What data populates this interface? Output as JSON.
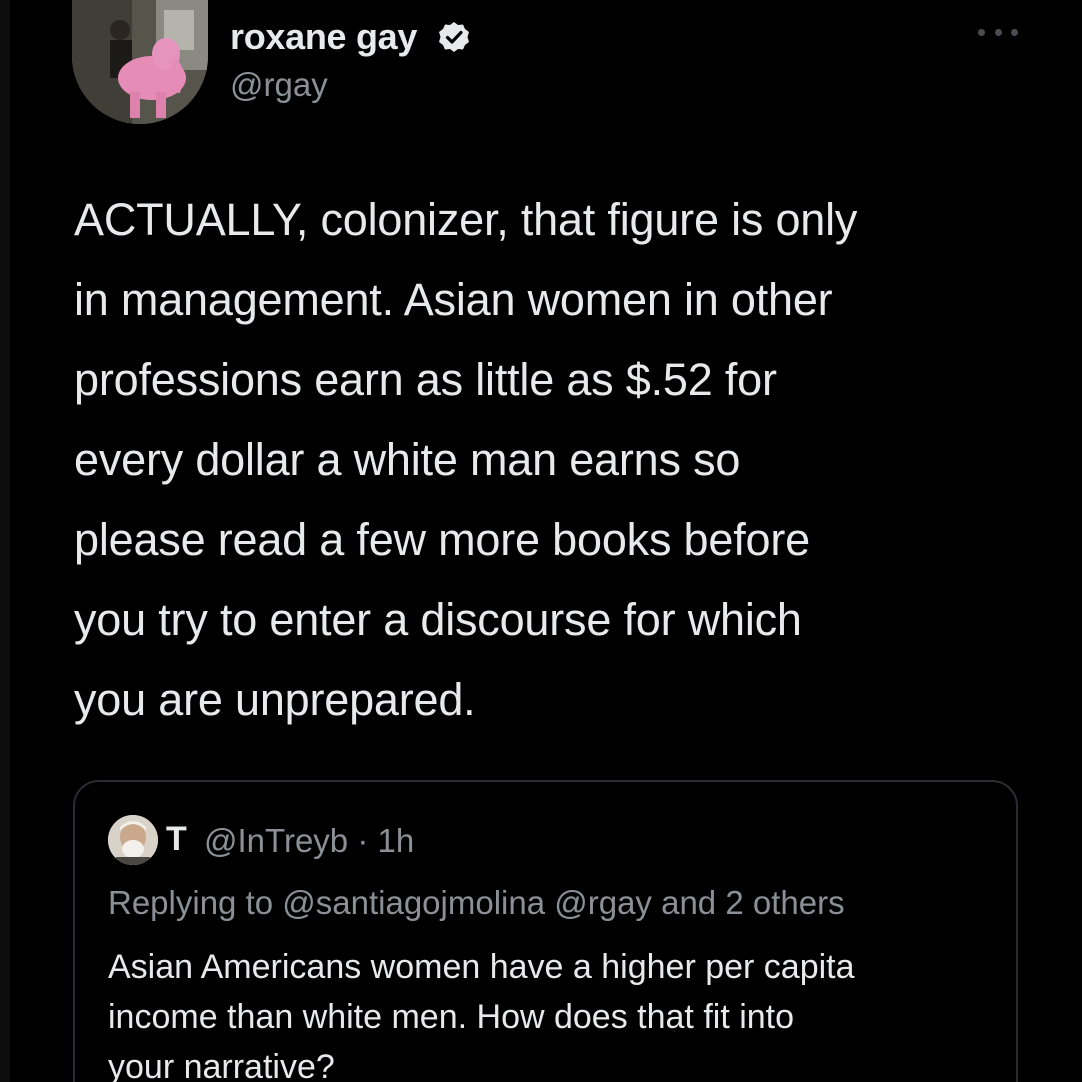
{
  "tweet": {
    "author_name": "roxane gay",
    "author_handle": "@rgay",
    "text_lines": [
      "ACTUALLY, colonizer, that figure is only",
      "in management. Asian women in other",
      "professions earn as little as $.52 for",
      "every dollar a white man earns so",
      "please read a few more books before",
      "you try to enter a discourse for which",
      "you are unprepared."
    ]
  },
  "quoted_tweet": {
    "author_name": "T",
    "author_handle_time": "@InTreyb · 1h",
    "replying_to": "Replying to @santiagojmolina @rgay and 2 others",
    "text_lines": [
      "Asian Americans women have a higher per capita",
      "income than white men.  How does that fit into",
      "your narrative?"
    ]
  },
  "icons": {
    "verified": "verified-badge-icon",
    "more": "more-options-icon"
  },
  "colors": {
    "background": "#000000",
    "text_primary": "#e7e9ea",
    "text_secondary": "#8b9096",
    "card_border": "#2a2d31"
  }
}
